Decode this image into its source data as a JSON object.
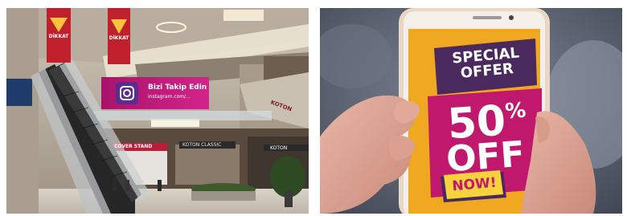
{
  "mall_photo": {
    "billboard_line1": "Bizi Takip Edin",
    "billboard_line2": "instagram.com/...",
    "left_banner_text": "DİKKAT",
    "right_banner_text": "DİKKAT",
    "store_sign_left": "COVER STAND",
    "store_sign_mid": "KOTON CLASSIC",
    "store_sign_right": "KOTON",
    "side_sign": "KOTON"
  },
  "phone_photo": {
    "headline": "SPECIAL OFFER",
    "discount_number": "50",
    "discount_percent": "%",
    "off_text": "OFF",
    "cta": "NOW!"
  },
  "colors": {
    "screen_orange": "#f0a820",
    "offer_purple": "#4a2a5e",
    "offer_magenta": "#c0186c",
    "billboard_magenta": "#c01c7a",
    "now_yellow": "#f7d23a"
  }
}
